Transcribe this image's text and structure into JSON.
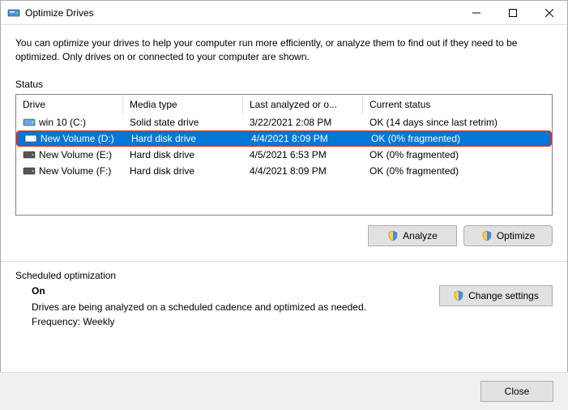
{
  "window": {
    "title": "Optimize Drives"
  },
  "intro": "You can optimize your drives to help your computer run more efficiently, or analyze them to find out if they need to be optimized. Only drives on or connected to your computer are shown.",
  "status_label": "Status",
  "columns": {
    "drive": "Drive",
    "media": "Media type",
    "last": "Last analyzed or o...",
    "status": "Current status"
  },
  "drives": [
    {
      "name": "win 10 (C:)",
      "media": "Solid state drive",
      "last": "3/22/2021 2:08 PM",
      "status": "OK (14 days since last retrim)",
      "selected": false,
      "ssd": true
    },
    {
      "name": "New Volume (D:)",
      "media": "Hard disk drive",
      "last": "4/4/2021 8:09 PM",
      "status": "OK (0% fragmented)",
      "selected": true,
      "ssd": false
    },
    {
      "name": "New Volume (E:)",
      "media": "Hard disk drive",
      "last": "4/5/2021 6:53 PM",
      "status": "OK (0% fragmented)",
      "selected": false,
      "ssd": false
    },
    {
      "name": "New Volume (F:)",
      "media": "Hard disk drive",
      "last": "4/4/2021 8:09 PM",
      "status": "OK (0% fragmented)",
      "selected": false,
      "ssd": false
    }
  ],
  "buttons": {
    "analyze": "Analyze",
    "optimize": "Optimize",
    "change_settings": "Change settings",
    "close": "Close"
  },
  "scheduled": {
    "label": "Scheduled optimization",
    "on": "On",
    "desc": "Drives are being analyzed on a scheduled cadence and optimized as needed.",
    "freq": "Frequency: Weekly"
  }
}
